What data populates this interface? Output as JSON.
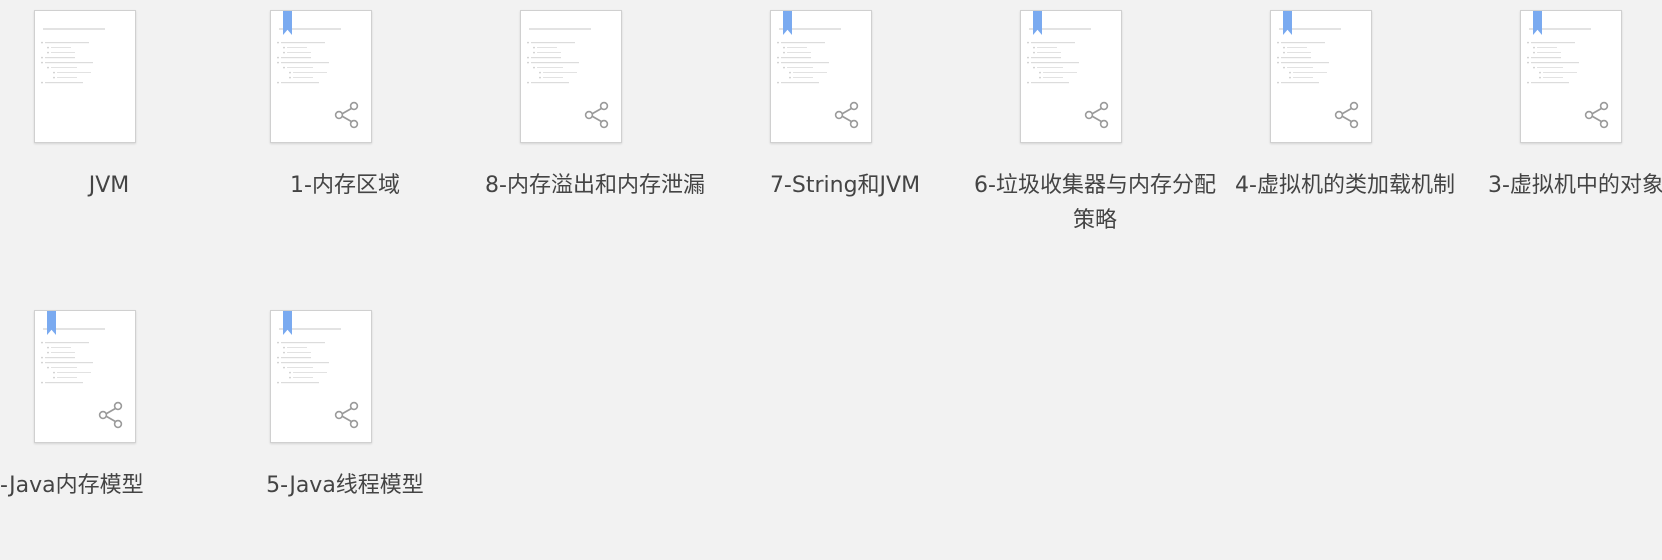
{
  "files": [
    {
      "name": "JVM",
      "bookmarked": false,
      "shareable": false
    },
    {
      "name": "1-内存区域",
      "bookmarked": true,
      "shareable": true
    },
    {
      "name": "8-内存溢出和内存泄漏",
      "bookmarked": false,
      "shareable": true
    },
    {
      "name": "7-String和JVM",
      "bookmarked": true,
      "shareable": true
    },
    {
      "name": "6-垃圾收集器与内存分配策略",
      "bookmarked": true,
      "shareable": true
    },
    {
      "name": "4-虚拟机的类加载机制",
      "bookmarked": true,
      "shareable": true
    },
    {
      "name": "3-虚拟机中的对象",
      "bookmarked": true,
      "shareable": true
    },
    {
      "name": "-Java内存模型",
      "bookmarked": true,
      "shareable": true
    },
    {
      "name": "5-Java线程模型",
      "bookmarked": true,
      "shareable": true
    }
  ],
  "colors": {
    "background": "#f2f2f2",
    "bookmark": "#7aaaf0",
    "text": "#444444",
    "icon": "#9a9a9a"
  }
}
